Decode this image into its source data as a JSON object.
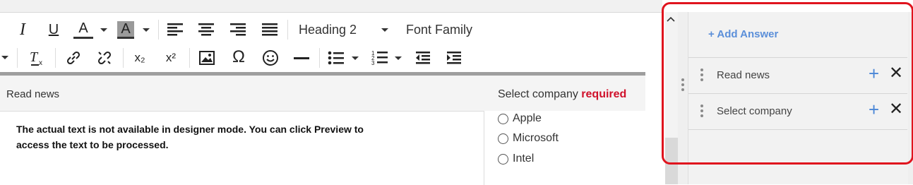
{
  "toolbar": {
    "row1": {
      "italic": "I",
      "underline": "U",
      "font_color": "A",
      "highlight": "A",
      "heading_select": "Heading 2",
      "font_family": "Font Family"
    },
    "row2": {
      "omega": "Ω",
      "subscript": "x₂",
      "superscript": "x²"
    }
  },
  "editor": {
    "title": "Read news",
    "instruction": "The actual text is not available in designer mode. You can click Preview to access the text to be processed."
  },
  "choices": {
    "label": "Select company",
    "required_label": "required",
    "options": [
      "Apple",
      "Microsoft",
      "Intel"
    ]
  },
  "answers_panel": {
    "add_answer": "+ Add Answer",
    "items": [
      {
        "label": "Read news"
      },
      {
        "label": "Select company"
      }
    ],
    "plus_symbol": "+",
    "close_symbol": "✕"
  },
  "colors": {
    "accent_blue": "#4a86d6",
    "required_red": "#d0102a",
    "highlight_frame": "#e0141e"
  }
}
